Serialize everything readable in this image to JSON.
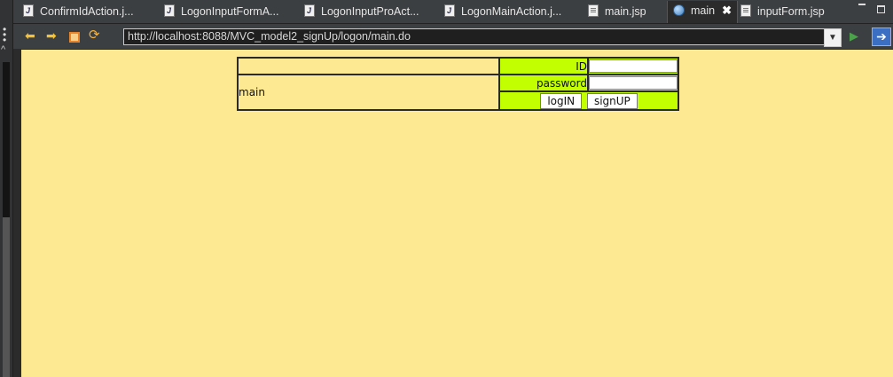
{
  "tabs": [
    {
      "label": "ConfirmIdAction.j...",
      "icon": "java-file-icon"
    },
    {
      "label": "LogonInputFormA...",
      "icon": "java-file-icon"
    },
    {
      "label": "LogonInputProAct...",
      "icon": "java-file-icon"
    },
    {
      "label": "LogonMainAction.j...",
      "icon": "java-file-icon"
    },
    {
      "label": "main.jsp",
      "icon": "jsp-file-icon"
    },
    {
      "label": "main",
      "icon": "globe-icon",
      "close": "✖"
    },
    {
      "label": "inputForm.jsp",
      "icon": "jsp-file-icon"
    }
  ],
  "browser": {
    "url": "http://localhost:8088/MVC_model2_signUp/logon/main.do"
  },
  "page": {
    "main_label": "main",
    "id_label": "ID",
    "password_label": "password",
    "id_value": "",
    "password_value": "",
    "login_button": "logIN",
    "signup_button": "signUP"
  },
  "colors": {
    "page_background": "#fde992",
    "form_background": "#c2ff00"
  }
}
